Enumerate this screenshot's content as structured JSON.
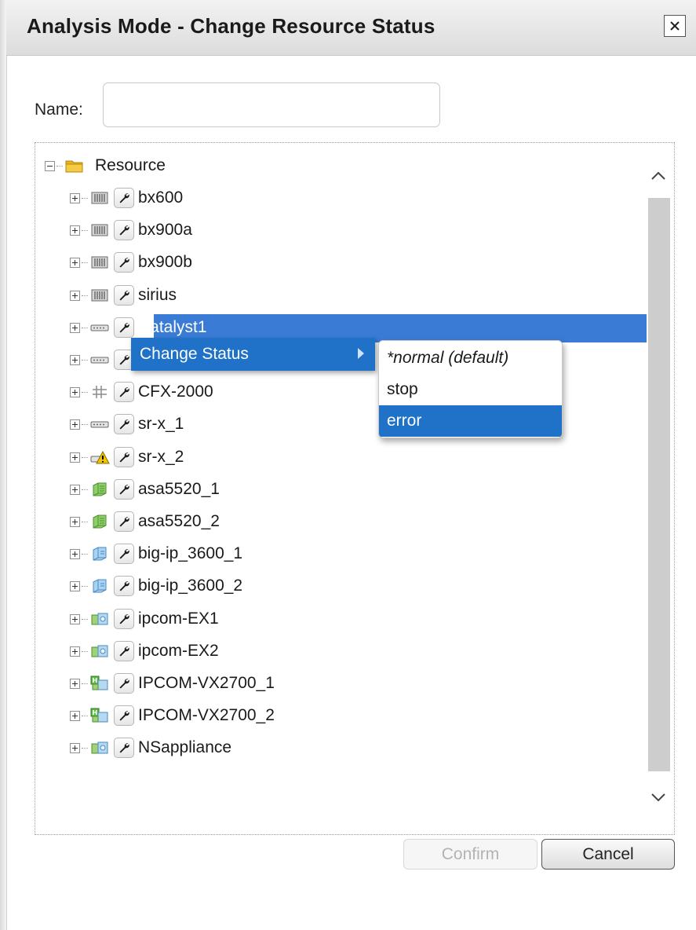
{
  "dialog": {
    "title": "Analysis Mode - Change Resource Status",
    "close_icon": "close-icon"
  },
  "form": {
    "name_label": "Name:",
    "name_value": "",
    "name_placeholder": ""
  },
  "tree": {
    "root_label": "Resource",
    "root_icon": "folder-icon",
    "items": [
      {
        "label": "bx600",
        "icon": "chassis-icon"
      },
      {
        "label": "bx900a",
        "icon": "chassis-icon"
      },
      {
        "label": "bx900b",
        "icon": "chassis-icon"
      },
      {
        "label": "sirius",
        "icon": "chassis-icon"
      },
      {
        "label": "Catalyst1",
        "icon": "switch-icon",
        "selected": true
      },
      {
        "label": "",
        "icon": "switch-icon"
      },
      {
        "label": "CFX-2000",
        "icon": "fabric-icon"
      },
      {
        "label": "sr-x_1",
        "icon": "switch-icon"
      },
      {
        "label": "sr-x_2",
        "icon": "switch-warning-icon"
      },
      {
        "label": "asa5520_1",
        "icon": "firewall-icon"
      },
      {
        "label": "asa5520_2",
        "icon": "firewall-icon"
      },
      {
        "label": "big-ip_3600_1",
        "icon": "load-balancer-icon"
      },
      {
        "label": "big-ip_3600_2",
        "icon": "load-balancer-icon"
      },
      {
        "label": "ipcom-EX1",
        "icon": "appliance-icon"
      },
      {
        "label": "ipcom-EX2",
        "icon": "appliance-icon"
      },
      {
        "label": "IPCOM-VX2700_1",
        "icon": "virtual-appliance-icon"
      },
      {
        "label": "IPCOM-VX2700_2",
        "icon": "virtual-appliance-icon"
      },
      {
        "label": "NSappliance",
        "icon": "appliance-icon"
      }
    ]
  },
  "context_menu": {
    "label": "Change Status",
    "submenu": [
      {
        "label": "*normal (default)",
        "italic": true
      },
      {
        "label": "stop"
      },
      {
        "label": "error",
        "active": true
      }
    ]
  },
  "buttons": {
    "confirm": "Confirm",
    "cancel": "Cancel"
  },
  "colors": {
    "selection": "#3a7bd5",
    "menu_highlight": "#1f72c7",
    "title_text": "#1a1a1a"
  }
}
